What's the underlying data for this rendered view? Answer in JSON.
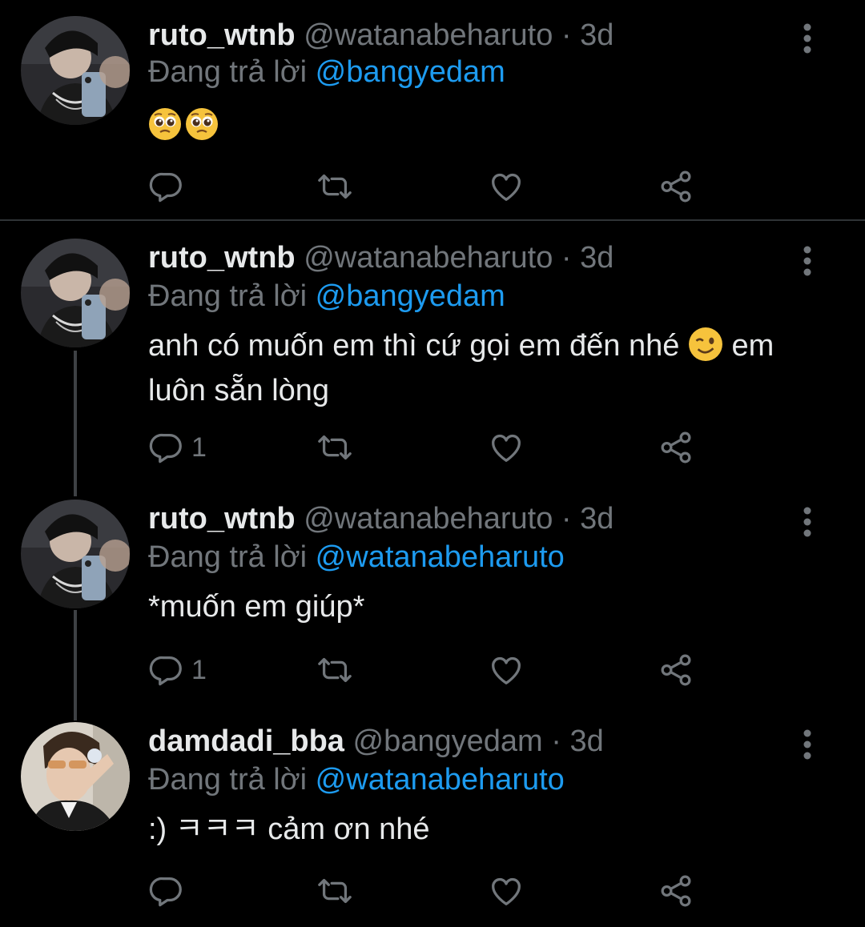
{
  "tweets": [
    {
      "name": "ruto_wtnb",
      "handle": "@watanabeharuto",
      "separator": "·",
      "time": "3d",
      "replying_prefix": "Đang trả lời",
      "replying_to": "@bangyedam",
      "text": "",
      "emoji": [
        "pleading-face",
        "pleading-face"
      ],
      "reply_count": "",
      "avatar": "avatar-ruto"
    },
    {
      "name": "ruto_wtnb",
      "handle": "@watanabeharuto",
      "separator": "·",
      "time": "3d",
      "replying_prefix": "Đang trả lời",
      "replying_to": "@bangyedam",
      "text_part1": "anh có muốn em thì cứ gọi em đến nhé",
      "text_part2": "em",
      "text_line2": "luôn sẵn lòng",
      "emoji": [
        "winking-face"
      ],
      "reply_count": "1",
      "avatar": "avatar-ruto"
    },
    {
      "name": "ruto_wtnb",
      "handle": "@watanabeharuto",
      "separator": "·",
      "time": "3d",
      "replying_prefix": "Đang trả lời",
      "replying_to": "@watanabeharuto",
      "text": "*muốn em giúp*",
      "reply_count": "1",
      "avatar": "avatar-ruto"
    },
    {
      "name": "damdadi_bba",
      "handle": "@bangyedam",
      "separator": "·",
      "time": "3d",
      "replying_prefix": "Đang trả lời",
      "replying_to": "@watanabeharuto",
      "text": ":) ㅋㅋㅋ cảm ơn nhé",
      "reply_count": "",
      "avatar": "avatar-bangyedam"
    }
  ],
  "icons": {
    "reply": "reply-icon",
    "retweet": "retweet-icon",
    "like": "heart-icon",
    "share": "share-icon",
    "more": "more-vertical-icon"
  },
  "colors": {
    "background": "#000000",
    "text": "#e7e9ea",
    "secondary": "#71767b",
    "mention": "#1d9bf0",
    "divider": "#2f3336"
  }
}
